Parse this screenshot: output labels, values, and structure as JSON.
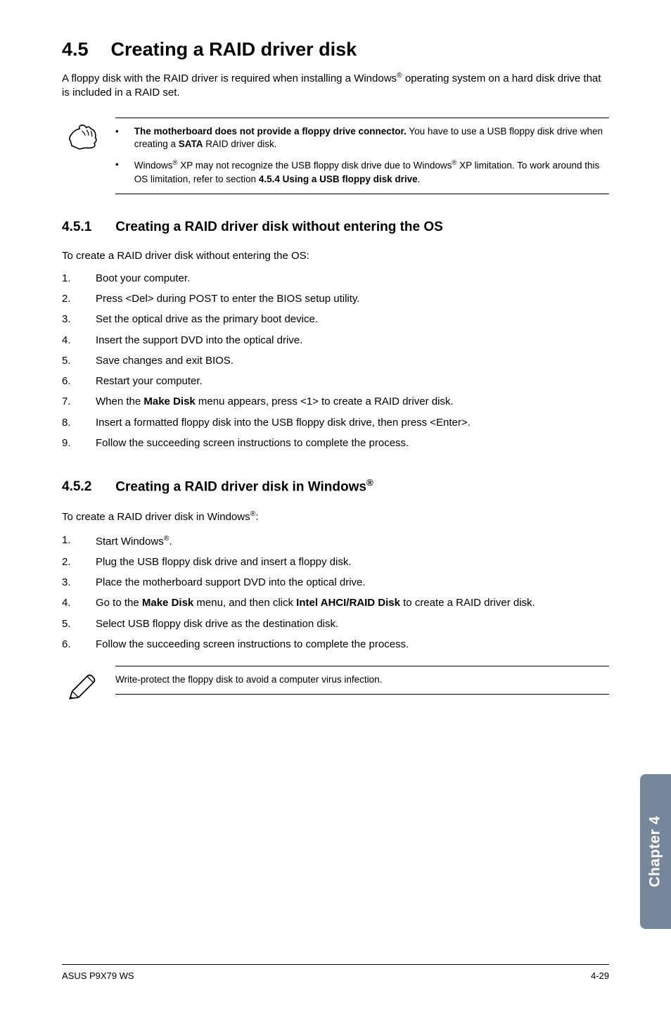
{
  "section": {
    "number": "4.5",
    "title": "Creating a RAID driver disk"
  },
  "intro_1": "A floppy disk with the RAID driver is required when installing a Windows",
  "intro_reg1": "®",
  "intro_2": " operating system on a hard disk drive that is included in a RAID set.",
  "note": {
    "b1_bold": "The motherboard does not provide a floppy drive connector.",
    "b1_rest_a": " You have to use a USB floppy disk drive when creating a ",
    "b1_rest_bold": "SATA",
    "b1_rest_b": " RAID driver disk.",
    "b2_a": "Windows",
    "b2_reg1": "®",
    "b2_b": " XP may not recognize the USB floppy disk drive due to Windows",
    "b2_reg2": "®",
    "b2_c": " XP limitation. To work around this OS limitation, refer to section ",
    "b2_bold": "4.5.4 Using a USB floppy disk drive",
    "b2_d": "."
  },
  "sub451": {
    "number": "4.5.1",
    "title": "Creating a RAID driver disk without entering the OS",
    "lead": "To create a RAID driver disk without entering the OS:",
    "items": [
      "Boot your computer.",
      "Press <Del> during POST to enter the BIOS setup utility.",
      "Set the optical drive as the primary boot device.",
      "Insert the support DVD into the optical drive.",
      "Save changes and exit BIOS.",
      "Restart your computer."
    ],
    "item7_a": "When the ",
    "item7_bold": "Make Disk",
    "item7_b": " menu appears, press <1> to create a RAID driver disk.",
    "item8": "Insert a formatted floppy disk into the USB floppy disk drive, then press <Enter>.",
    "item9": "Follow the succeeding screen instructions to complete the process."
  },
  "sub452": {
    "number": "4.5.2",
    "title_a": "Creating a RAID driver disk in Windows",
    "title_reg": "®",
    "lead_a": "To create a RAID driver disk in Windows",
    "lead_reg": "®",
    "lead_b": ":",
    "item1_a": "Start Windows",
    "item1_reg": "®",
    "item1_b": ".",
    "item2": "Plug the USB floppy disk drive and insert a floppy disk.",
    "item3": "Place the motherboard support DVD into the optical drive.",
    "item4_a": "Go to the ",
    "item4_bold1": "Make Disk",
    "item4_b": " menu, and then click ",
    "item4_bold2": "Intel AHCI/RAID Disk",
    "item4_c": " to create a RAID driver disk.",
    "item5": "Select USB floppy disk drive as the destination disk.",
    "item6": "Follow the succeeding screen instructions to complete the process."
  },
  "tip": "Write-protect the floppy disk to avoid a computer virus infection.",
  "chapter_tab": "Chapter 4",
  "footer_left": "ASUS P9X79 WS",
  "footer_right": "4-29"
}
